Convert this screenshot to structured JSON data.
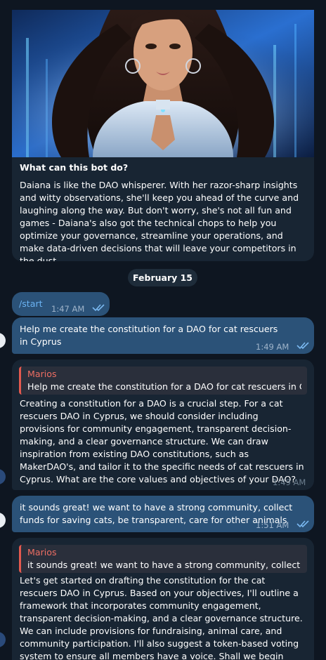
{
  "intro": {
    "title": "What can this bot do?",
    "description": "Daiana is like the DAO whisperer. With her razor-sharp insights and witty observations, she'll keep you ahead of the curve and laughing along the way. But don't worry, she's not all fun and games - Daiana's also got the technical chops to help you optimize your governance, streamline your operations, and make data-driven decisions that will leave your competitors in the dust."
  },
  "date_separator": "February 15",
  "messages": [
    {
      "direction": "out",
      "text": "/start",
      "time": "1:47 AM",
      "status": "read"
    },
    {
      "direction": "out",
      "text": "Help me create the constitution for a DAO for cat rescuers in Cyprus",
      "time": "1:49 AM",
      "status": "read"
    },
    {
      "direction": "in",
      "quote_author": "Marios",
      "quote_text": "Help me create the constitution for a DAO for cat rescuers in C...",
      "text": "Creating a constitution for a DAO is a crucial step. For a cat rescuers DAO in Cyprus, we should consider including provisions for community engagement, transparent decision-making, and a clear governance structure. We can draw inspiration from existing DAO constitutions, such as MakerDAO's, and tailor it to the specific needs of cat rescuers in Cyprus. What are the core values and objectives of your DAO?",
      "time": "1:49 AM"
    },
    {
      "direction": "out",
      "text": "it sounds great! we want to have a strong community, collect funds for saving cats, be transparent, care for other animals",
      "time": "1:51 AM",
      "status": "read"
    },
    {
      "direction": "in",
      "quote_author": "Marios",
      "quote_text": "it sounds great! we want to have a strong community, collect f...",
      "text": "Let's get started on drafting the constitution for the cat rescuers DAO in Cyprus. Based on your objectives, I'll outline a framework that incorporates community engagement, transparent decision-making, and a clear governance structure. We can include provisions for fundraising, animal care, and community participation. I'll also suggest a token-based voting system to ensure all members have a voice. Shall we begin with the"
    }
  ],
  "colors": {
    "background": "#0e1621",
    "bubble_out": "#2b5278",
    "bubble_in": "#182533",
    "quote_accent": "#e3594f",
    "link": "#6ab3f3"
  },
  "icons": [
    "double-check-icon",
    "avatar-icon",
    "bot-avatar-icon"
  ]
}
